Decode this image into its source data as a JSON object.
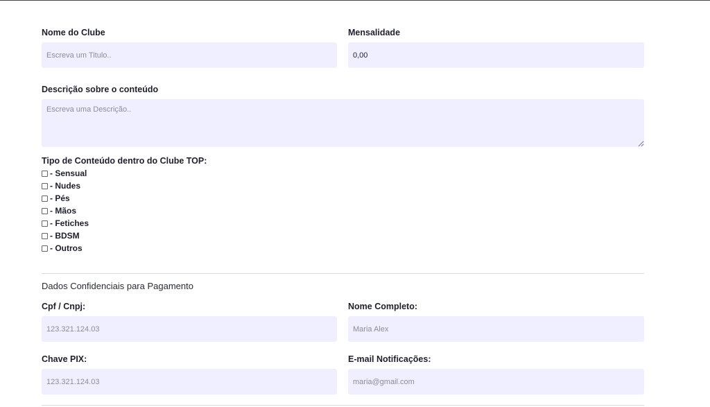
{
  "form": {
    "club_name": {
      "label": "Nome do Clube",
      "placeholder": "Escreva um Titulo..",
      "value": ""
    },
    "monthly_fee": {
      "label": "Mensalidade",
      "value": "0,00"
    },
    "description": {
      "label": "Descrição sobre o conteúdo",
      "placeholder": "Escreva uma Descrição..",
      "value": ""
    },
    "content_types": {
      "label": "Tipo de Conteúdo dentro do Clube TOP:",
      "options": [
        {
          "label": "- Sensual",
          "checked": false
        },
        {
          "label": "- Nudes",
          "checked": false
        },
        {
          "label": "- Pés",
          "checked": false
        },
        {
          "label": "- Mãos",
          "checked": false
        },
        {
          "label": "- Fetiches",
          "checked": false
        },
        {
          "label": "- BDSM",
          "checked": false
        },
        {
          "label": "- Outros",
          "checked": false
        }
      ]
    }
  },
  "payment": {
    "title": "Dados Confidenciais para Pagamento",
    "cpf": {
      "label": "Cpf / Cnpj:",
      "placeholder": "123.321.124.03"
    },
    "full_name": {
      "label": "Nome Completo:",
      "placeholder": "Maria Alex"
    },
    "pix": {
      "label": "Chave PIX:",
      "placeholder": "123.321.124.03"
    },
    "email": {
      "label": "E-mail Notificações:",
      "placeholder": "maria@gmail.com"
    }
  }
}
